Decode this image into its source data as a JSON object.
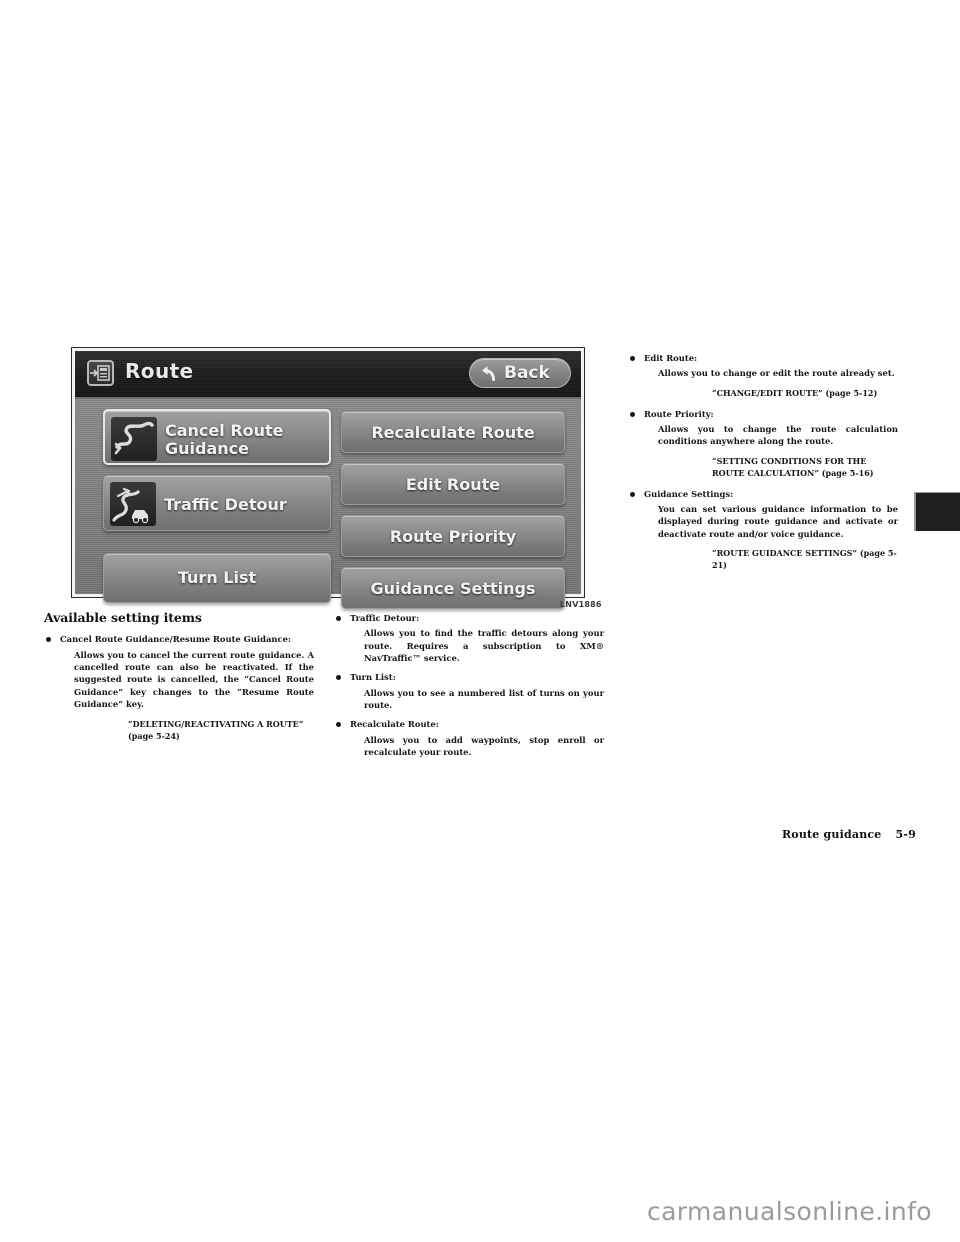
{
  "figure": {
    "header": {
      "icon": "screen-arrow-icon",
      "title": "Route",
      "back_icon": "back-arrow-icon",
      "back_label": "Back"
    },
    "buttons": [
      {
        "id": "cancel",
        "label": "Cancel Route\nGuidance",
        "icon": "winding-route-icon",
        "selected": true
      },
      {
        "id": "traffic",
        "label": "Traffic Detour",
        "icon": "route-with-car-icon",
        "selected": false
      },
      {
        "id": "turn",
        "label": "Turn List",
        "icon": "none",
        "selected": false
      },
      {
        "id": "recalc",
        "label": "Recalculate Route",
        "icon": "none",
        "selected": false
      },
      {
        "id": "edit",
        "label": "Edit Route",
        "icon": "none",
        "selected": false
      },
      {
        "id": "prio",
        "label": "Route Priority",
        "icon": "none",
        "selected": false
      },
      {
        "id": "guid",
        "label": "Guidance Settings",
        "icon": "none",
        "selected": false
      }
    ],
    "figure_code": "LNV1886"
  },
  "columns": {
    "left": {
      "section_title": "Available setting items",
      "items": [
        {
          "head": "Cancel Route Guidance/Resume Route Guidance:",
          "body": "Allows you to cancel the current route guidance. A cancelled route can also be reactivated. If the suggested route is cancelled, the “Cancel Route Guidance” key changes to the “Resume Route Guidance” key.",
          "xref": "“DELETING/REACTIVATING A ROUTE” (page 5-24)"
        }
      ]
    },
    "mid": {
      "items": [
        {
          "head": "Traffic Detour:",
          "body": "Allows you to find the traffic detours along your route. Requires a subscription to XM® NavTraffic™ service.",
          "xref": ""
        },
        {
          "head": "Turn List:",
          "body": "Allows you to see a numbered list of turns on your route.",
          "xref": ""
        },
        {
          "head": "Recalculate Route:",
          "body": "Allows you to add waypoints, stop enroll or recalculate your route.",
          "xref": ""
        }
      ]
    },
    "right": {
      "items": [
        {
          "head": "Edit Route:",
          "body": "Allows you to change or edit the route already set.",
          "xref": "“CHANGE/EDIT ROUTE” (page 5-12)"
        },
        {
          "head": "Route Priority:",
          "body": "Allows you to change the route calculation conditions anywhere along the route.",
          "xref": "“SETTING CONDITIONS FOR THE ROUTE CALCULATION” (page 5-16)"
        },
        {
          "head": "Guidance Settings:",
          "body": "You can set various guidance information to be displayed during route guidance and activate or deactivate route and/or voice guidance.",
          "xref": "“ROUTE GUIDANCE SETTINGS” (page 5-21)"
        }
      ]
    }
  },
  "footer": {
    "section": "Route guidance",
    "page": "5-9"
  },
  "watermark": "carmanualsonline.info"
}
